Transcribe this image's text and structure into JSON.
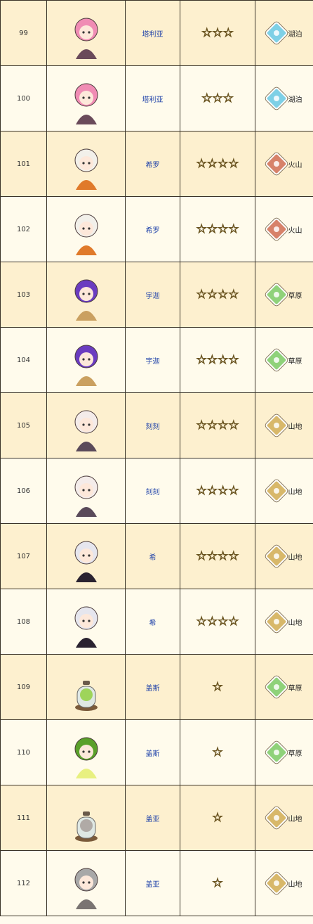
{
  "rows": [
    {
      "no": "99",
      "name": "塔利亚",
      "stars": "☆☆☆",
      "habitat": "湖泊",
      "habitat_color": "#7ed0e6",
      "sprite": "pink-hair-scythe-icon",
      "hair": "#f08cb4",
      "accent": "#6a4a5a"
    },
    {
      "no": "100",
      "name": "塔利亚",
      "stars": "☆☆☆",
      "habitat": "湖泊",
      "habitat_color": "#7ed0e6",
      "sprite": "pink-hair-scythe-icon",
      "hair": "#f08cb4",
      "accent": "#6a4a5a"
    },
    {
      "no": "101",
      "name": "希罗",
      "stars": "☆☆☆☆",
      "habitat": "火山",
      "habitat_color": "#d7826a",
      "sprite": "white-hair-basket-icon",
      "hair": "#f2f0ea",
      "accent": "#e07a2a"
    },
    {
      "no": "102",
      "name": "希罗",
      "stars": "☆☆☆☆",
      "habitat": "火山",
      "habitat_color": "#d7826a",
      "sprite": "white-hair-basket-icon",
      "hair": "#f2f0ea",
      "accent": "#e07a2a"
    },
    {
      "no": "103",
      "name": "宇迦",
      "stars": "☆☆☆☆",
      "habitat": "草原",
      "habitat_color": "#8fd27a",
      "sprite": "purple-hair-pot-icon",
      "hair": "#6a3cc0",
      "accent": "#caa060"
    },
    {
      "no": "104",
      "name": "宇迦",
      "stars": "☆☆☆☆",
      "habitat": "草原",
      "habitat_color": "#8fd27a",
      "sprite": "purple-hair-pot-icon",
      "hair": "#6a3cc0",
      "accent": "#caa060"
    },
    {
      "no": "105",
      "name": "刻刻",
      "stars": "☆☆☆☆",
      "habitat": "山地",
      "habitat_color": "#d8b86a",
      "sprite": "bunny-clock-icon",
      "hair": "#f4ecea",
      "accent": "#5a4a5a"
    },
    {
      "no": "106",
      "name": "刻刻",
      "stars": "☆☆☆☆",
      "habitat": "山地",
      "habitat_color": "#d8b86a",
      "sprite": "bunny-clock-icon",
      "hair": "#f4ecea",
      "accent": "#5a4a5a"
    },
    {
      "no": "107",
      "name": "希",
      "stars": "☆☆☆☆",
      "habitat": "山地",
      "habitat_color": "#d8b86a",
      "sprite": "witch-staff-icon",
      "hair": "#e6e6ee",
      "accent": "#2a2230"
    },
    {
      "no": "108",
      "name": "希",
      "stars": "☆☆☆☆",
      "habitat": "山地",
      "habitat_color": "#d8b86a",
      "sprite": "witch-staff-icon",
      "hair": "#e6e6ee",
      "accent": "#2a2230"
    },
    {
      "no": "109",
      "name": "盖斯",
      "stars": "☆",
      "habitat": "草原",
      "habitat_color": "#8fd27a",
      "sprite": "green-egg-jar-icon",
      "hair": "#9ed45a",
      "accent": "#c0c8c0"
    },
    {
      "no": "110",
      "name": "盖斯",
      "stars": "☆",
      "habitat": "草原",
      "habitat_color": "#8fd27a",
      "sprite": "green-snail-girl-icon",
      "hair": "#5aa02a",
      "accent": "#e8f080"
    },
    {
      "no": "111",
      "name": "盖亚",
      "stars": "☆",
      "habitat": "山地",
      "habitat_color": "#d8b86a",
      "sprite": "grey-egg-jar-icon",
      "hair": "#b0aaa6",
      "accent": "#c0c8c0"
    },
    {
      "no": "112",
      "name": "盖亚",
      "stars": "☆",
      "habitat": "山地",
      "habitat_color": "#d8b86a",
      "sprite": "grey-hair-girl-icon",
      "hair": "#a8a8a8",
      "accent": "#7a7472"
    }
  ]
}
